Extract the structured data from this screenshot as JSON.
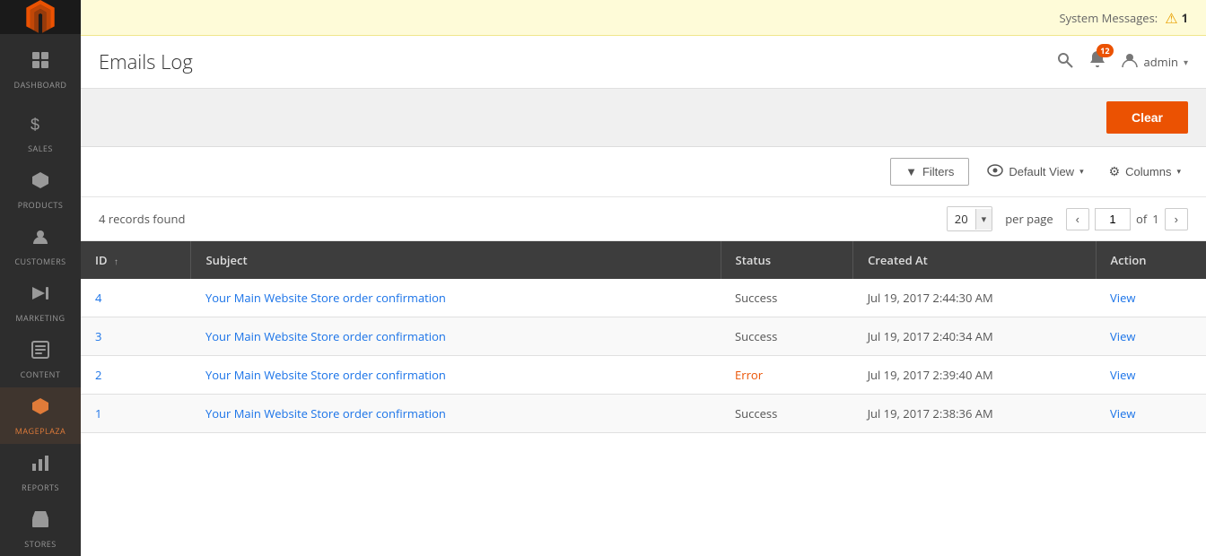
{
  "sidebar": {
    "items": [
      {
        "id": "dashboard",
        "label": "DASHBOARD",
        "icon": "⊟"
      },
      {
        "id": "sales",
        "label": "SALES",
        "icon": "$"
      },
      {
        "id": "products",
        "label": "PRODUCTS",
        "icon": "◈"
      },
      {
        "id": "customers",
        "label": "CUSTOMERS",
        "icon": "👤"
      },
      {
        "id": "marketing",
        "label": "MARKETING",
        "icon": "📢"
      },
      {
        "id": "content",
        "label": "CONTENT",
        "icon": "▦"
      },
      {
        "id": "mageplaza",
        "label": "MAGEPLAZA",
        "icon": "◆"
      },
      {
        "id": "reports",
        "label": "REPORTS",
        "icon": "📊"
      },
      {
        "id": "stores",
        "label": "STORES",
        "icon": "🏪"
      }
    ]
  },
  "system_messages": {
    "label": "System Messages:",
    "count": "1"
  },
  "header": {
    "title": "Emails Log",
    "notification_count": "12",
    "admin_label": "admin"
  },
  "toolbar": {
    "clear_label": "Clear"
  },
  "grid": {
    "filters_label": "Filters",
    "view_label": "Default View",
    "columns_label": "Columns",
    "records_found": "4 records found",
    "per_page": "20",
    "per_page_label": "per page",
    "current_page": "1",
    "total_pages": "1"
  },
  "table": {
    "columns": [
      {
        "id": "id",
        "label": "ID"
      },
      {
        "id": "subject",
        "label": "Subject"
      },
      {
        "id": "status",
        "label": "Status"
      },
      {
        "id": "created_at",
        "label": "Created At"
      },
      {
        "id": "action",
        "label": "Action"
      }
    ],
    "rows": [
      {
        "id": "4",
        "subject": "Your Main Website Store order confirmation",
        "status": "Success",
        "status_class": "success",
        "created_at": "Jul 19, 2017 2:44:30 AM",
        "action": "View"
      },
      {
        "id": "3",
        "subject": "Your Main Website Store order confirmation",
        "status": "Success",
        "status_class": "success",
        "created_at": "Jul 19, 2017 2:40:34 AM",
        "action": "View"
      },
      {
        "id": "2",
        "subject": "Your Main Website Store order confirmation",
        "status": "Error",
        "status_class": "error",
        "created_at": "Jul 19, 2017 2:39:40 AM",
        "action": "View"
      },
      {
        "id": "1",
        "subject": "Your Main Website Store order confirmation",
        "status": "Success",
        "status_class": "success",
        "created_at": "Jul 19, 2017 2:38:36 AM",
        "action": "View"
      }
    ]
  }
}
